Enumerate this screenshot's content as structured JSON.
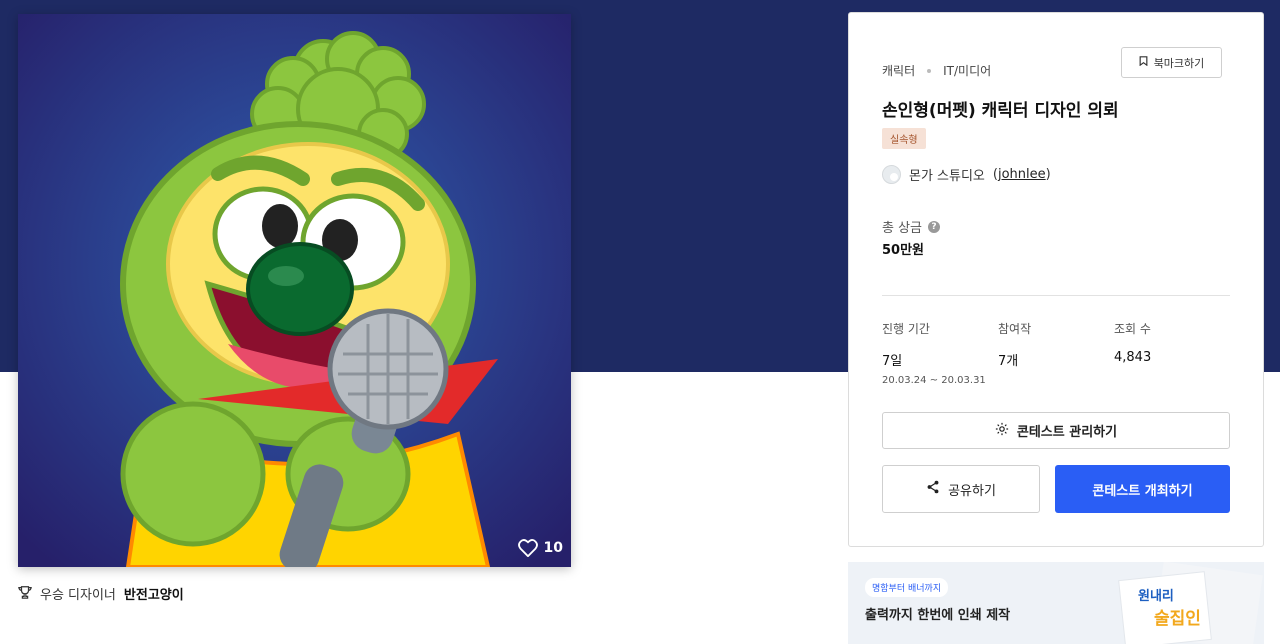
{
  "hero": {
    "image_description_icon": "fuzzy-green-puppet-mascot",
    "likes": "10"
  },
  "winner": {
    "label": "우승 디자이너",
    "name": "반전고양이"
  },
  "contest": {
    "category": "캐릭터",
    "subcategory": "IT/미디어",
    "bookmark_label": "북마크하기",
    "title": "손인형(머펫) 캐릭터 디자인 의뢰",
    "tag": "실속형",
    "host_name": "몬가 스튜디오",
    "host_id": "johnlee",
    "prize_label": "총 상금",
    "prize_value": "50만원",
    "stats": {
      "period_label": "진행 기간",
      "period_value": "7일",
      "period_range": "20.03.24 ~ 20.03.31",
      "entries_label": "참여작",
      "entries_value": "7개",
      "views_label": "조회 수",
      "views_value": "4,843"
    },
    "manage_label": "콘테스트 관리하기",
    "share_label": "공유하기",
    "host_contest_label": "콘테스트 개최하기"
  },
  "ad": {
    "tag": "명함부터 배너까지",
    "text": "출력까지 한번에 인쇄 제작",
    "art_text": "원내리 술집인"
  },
  "colors": {
    "banner": "#1e2a63",
    "primary_button": "#2a5ef5",
    "tag_bg": "#f6e1d6"
  }
}
